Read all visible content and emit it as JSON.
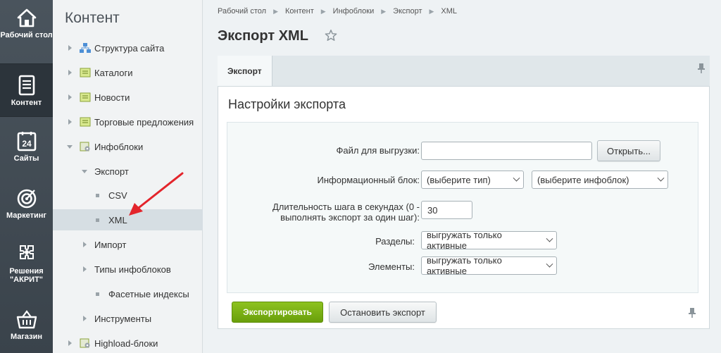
{
  "rail": {
    "items": [
      {
        "label": "Рабочий стол",
        "icon": "home-icon"
      },
      {
        "label": "Контент",
        "icon": "document-icon",
        "active": true
      },
      {
        "label": "Сайты",
        "icon": "calendar-24-icon"
      },
      {
        "label": "Маркетинг",
        "icon": "target-icon"
      },
      {
        "label": "Решения \"АКРИТ\"",
        "icon": "puzzle-icon"
      },
      {
        "label": "Магазин",
        "icon": "basket-icon"
      }
    ]
  },
  "tree": {
    "title": "Контент",
    "items": [
      {
        "label": "Структура сайта"
      },
      {
        "label": "Каталоги"
      },
      {
        "label": "Новости"
      },
      {
        "label": "Торговые предложения"
      },
      {
        "label": "Инфоблоки"
      },
      {
        "label": "Экспорт"
      },
      {
        "label": "CSV"
      },
      {
        "label": "XML",
        "selected": true
      },
      {
        "label": "Импорт"
      },
      {
        "label": "Типы инфоблоков"
      },
      {
        "label": "Фасетные индексы"
      },
      {
        "label": "Инструменты"
      },
      {
        "label": "Highload-блоки"
      }
    ]
  },
  "breadcrumbs": [
    "Рабочий стол",
    "Контент",
    "Инфоблоки",
    "Экспорт",
    "XML"
  ],
  "page_title": "Экспорт XML",
  "tab_label": "Экспорт",
  "panel_title": "Настройки экспорта",
  "form": {
    "file_label": "Файл для выгрузки:",
    "file_value": "",
    "open_button": "Открыть...",
    "iblock_label": "Информационный блок:",
    "type_select": "(выберите тип)",
    "iblock_select": "(выберите инфоблок)",
    "step_label_1": "Длительность шага в секундах (0 -",
    "step_label_2": "выполнять экспорт за один шаг):",
    "step_value": "30",
    "sections_label": "Разделы:",
    "sections_value": "выгружать только активные",
    "elements_label": "Элементы:",
    "elements_value": "выгружать только активные"
  },
  "buttons": {
    "export": "Экспортировать",
    "stop": "Остановить экспорт"
  },
  "colors": {
    "accent_green": "#7cb514",
    "rail_bg": "#434c54",
    "annotation_arrow": "#e3242b"
  }
}
